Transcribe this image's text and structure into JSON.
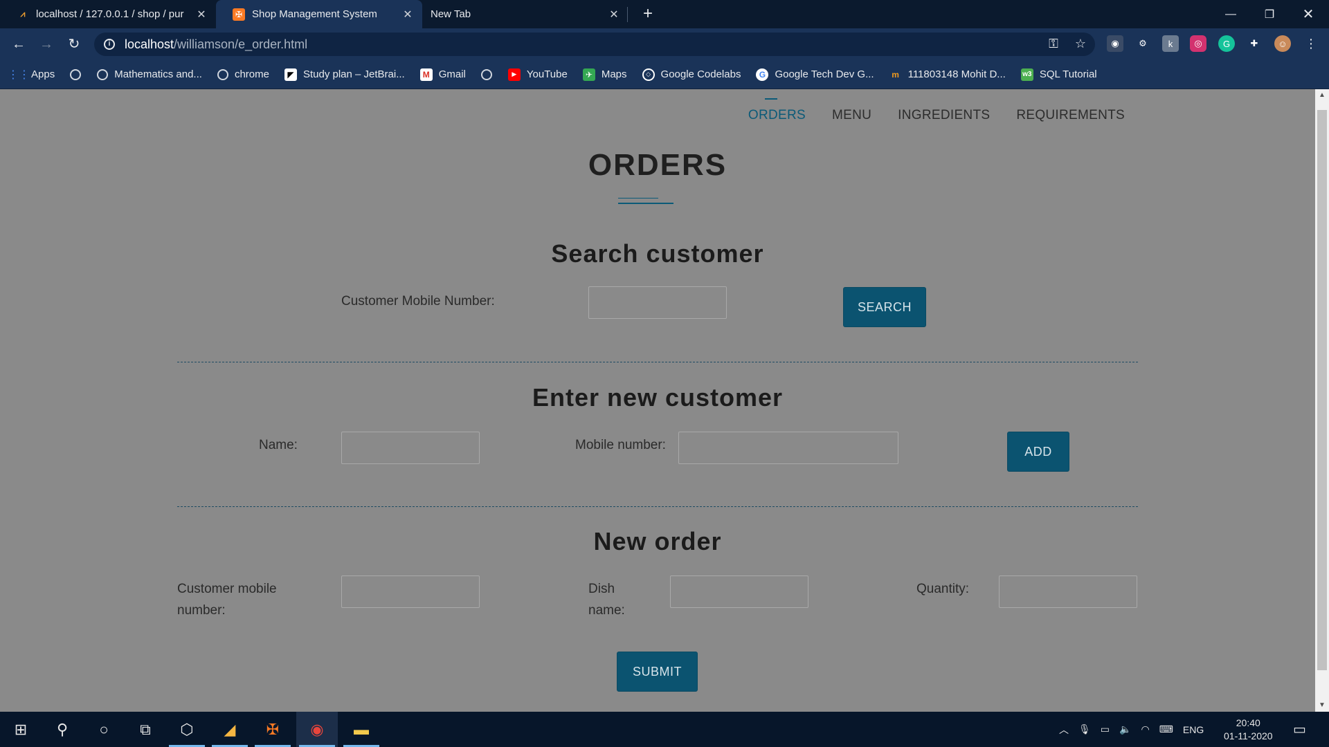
{
  "browser": {
    "tabs": [
      {
        "title": "localhost / 127.0.0.1 / shop / pur",
        "favicon": "phpmyadmin-icon"
      },
      {
        "title": "Shop Management System",
        "favicon": "xampp-icon"
      },
      {
        "title": "New Tab",
        "favicon": ""
      }
    ],
    "new_tab_symbol": "+",
    "url_host": "localhost",
    "url_path": "/williamson/e_order.html",
    "bookmarks": [
      {
        "label": "Apps",
        "icon": "apps-grid-icon"
      },
      {
        "label": "",
        "icon": "globe-icon"
      },
      {
        "label": "Mathematics and...",
        "icon": "globe-icon"
      },
      {
        "label": "chrome",
        "icon": "globe-icon"
      },
      {
        "label": "Study plan – JetBrai...",
        "icon": "jetbrains-icon"
      },
      {
        "label": "Gmail",
        "icon": "gmail-icon"
      },
      {
        "label": "",
        "icon": "globe-icon"
      },
      {
        "label": "YouTube",
        "icon": "youtube-icon"
      },
      {
        "label": "Maps",
        "icon": "maps-icon"
      },
      {
        "label": "Google Codelabs",
        "icon": "codelabs-icon"
      },
      {
        "label": "Google Tech Dev G...",
        "icon": "google-icon"
      },
      {
        "label": "111803148 Mohit D...",
        "icon": "mint-icon"
      },
      {
        "label": "SQL Tutorial",
        "icon": "w3schools-icon"
      }
    ]
  },
  "site": {
    "nav": [
      {
        "label": "ORDERS",
        "active": true
      },
      {
        "label": "MENU",
        "active": false
      },
      {
        "label": "INGREDIENTS",
        "active": false
      },
      {
        "label": "REQUIREMENTS",
        "active": false
      }
    ],
    "page_title": "ORDERS",
    "search": {
      "heading": "Search customer",
      "label": "Customer Mobile Number:",
      "button": "SEARCH"
    },
    "new_customer": {
      "heading": "Enter new customer",
      "name_label": "Name:",
      "mobile_label": "Mobile number:",
      "button": "ADD"
    },
    "new_order": {
      "heading": "New order",
      "mobile_label_line1": "Customer mobile",
      "mobile_label_line2": "number:",
      "dish_label_line1": "Dish",
      "dish_label_line2": "name:",
      "quantity_label": "Quantity:",
      "button": "SUBMIT"
    }
  },
  "taskbar": {
    "language": "ENG",
    "time": "20:40",
    "date": "01-11-2020"
  },
  "colors": {
    "accent": "#0b5370",
    "page_bg": "#8a8a8a",
    "browser_chrome": "#1a3358"
  }
}
